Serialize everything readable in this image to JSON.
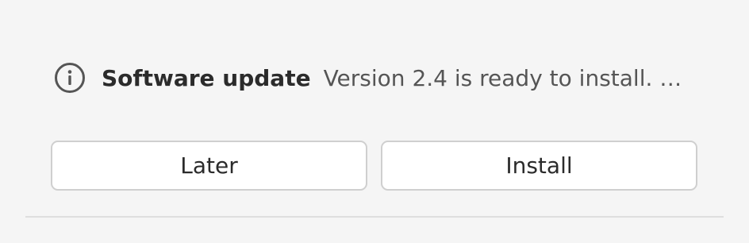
{
  "notification": {
    "icon": "info-icon",
    "title": "Software update",
    "message": "Version 2.4 is ready to install. …"
  },
  "actions": {
    "later_label": "Later",
    "install_label": "Install"
  }
}
